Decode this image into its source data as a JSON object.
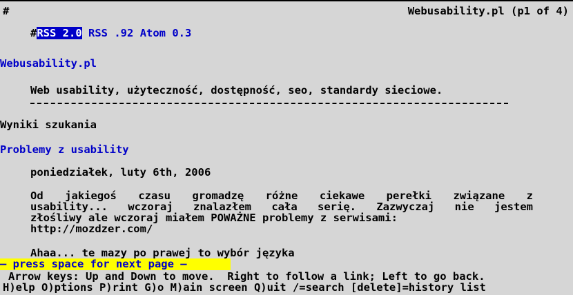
{
  "header": {
    "hash": "#",
    "title": "Webusability.pl (p1 of 4)"
  },
  "feeds": {
    "hash": "#",
    "selected": "RSS 2.0",
    "rss092": "RSS .92",
    "atom": "Atom 0.3"
  },
  "site": {
    "name": "Webusability.pl",
    "tagline": "Web usability, użyteczność, dostępność, seo, standardy sieciowe."
  },
  "search_results_heading": "Wyniki szukania",
  "post": {
    "title": "Problemy z usability",
    "date": "poniedziałek, luty 6th, 2006",
    "body_lines": [
      "Od jakiegoś czasu gromadzę różne ciekawe perełki związane z",
      "usability... wczoraj znalazłem cała serię. Zazwyczaj nie jestem",
      "złośliwy ale wczoraj miałem POWAŻNE problemy z serwisami:",
      "http://mozdzer.com/"
    ],
    "next_line": "Ahaa... te mazy po prawej to wybór języka"
  },
  "status": {
    "prompt": "— press space for next page —"
  },
  "help": {
    "line1": "Arrow keys: Up and Down to move.  Right to follow a link; Left to go back.",
    "line2": "H)elp O)ptions P)rint G)o M)ain screen Q)uit /=search [delete]=history list"
  },
  "colors": {
    "background": "#d6d6d6",
    "link": "#0000c8",
    "highlight": "#0000c8",
    "status_bar": "#ffff00",
    "text": "#000000"
  }
}
